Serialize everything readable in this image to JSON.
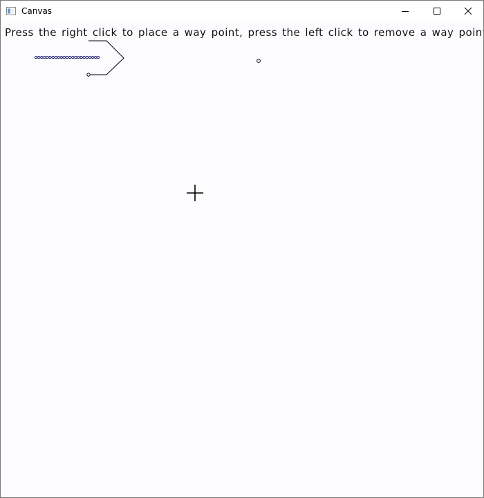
{
  "window": {
    "title": "Canvas",
    "icon": "app-window-icon",
    "controls": [
      "minimize-icon",
      "maximize-icon",
      "close-icon"
    ]
  },
  "canvas": {
    "instruction": "Press the right click to place a way point, press the left click to remove a way point",
    "stroke_color": "#000000",
    "trail_color": "#1a1a6e",
    "background_color": "#fcfcfe"
  }
}
